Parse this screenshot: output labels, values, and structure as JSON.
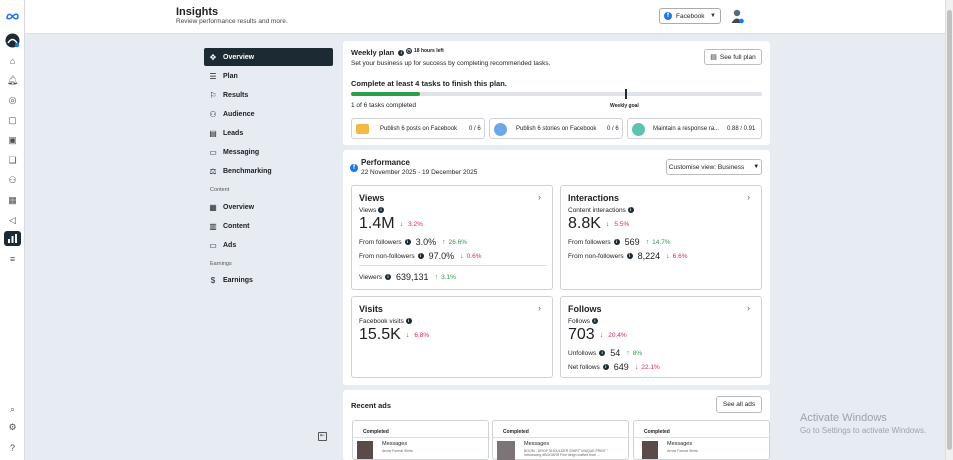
{
  "app": {
    "logo": "meta-infinity-logo"
  },
  "header": {
    "title": "Insights",
    "subtitle": "Review performance results and more.",
    "account_select": "Facebook"
  },
  "nav": {
    "items": [
      {
        "label": "Overview",
        "icon": "overview-icon"
      },
      {
        "label": "Plan",
        "icon": "list-icon"
      },
      {
        "label": "Results",
        "icon": "results-icon"
      },
      {
        "label": "Audience",
        "icon": "audience-icon"
      },
      {
        "label": "Leads",
        "icon": "leads-icon"
      },
      {
        "label": "Messaging",
        "icon": "messaging-icon"
      },
      {
        "label": "Benchmarking",
        "icon": "benchmarking-icon"
      }
    ],
    "content_section": "Content",
    "content_items": [
      {
        "label": "Overview"
      },
      {
        "label": "Content"
      },
      {
        "label": "Ads"
      }
    ],
    "earnings_section": "Earnings",
    "earnings_items": [
      {
        "label": "Earnings"
      }
    ]
  },
  "weekly_plan": {
    "title": "Weekly plan",
    "time_left": "18 hours left",
    "description": "Set your business up for success by completing recommended tasks.",
    "see_full_plan": "See full plan",
    "goal_text": "Complete at least 4 tasks to finish this plan.",
    "progress_text": "1 of 6 tasks completed",
    "progress_fraction": 0.1667,
    "goal_marker_fraction": 0.667,
    "weekly_goal_label": "Weekly goal",
    "tasks": [
      {
        "label": "Publish 6 posts on Facebook",
        "count": "0 / 6"
      },
      {
        "label": "Publish 6 stories on Facebook",
        "count": "0 / 6"
      },
      {
        "label": "Maintain a response ra...",
        "count": "0.88 / 0.91"
      }
    ]
  },
  "performance": {
    "title": "Performance",
    "date_range": "22 November 2025 - 19 December 2025",
    "customise_view": "Customise view: Business",
    "views": {
      "title": "Views",
      "metric_label": "Views",
      "value": "1.4M",
      "change": "3.2%",
      "rows": [
        {
          "label": "From followers",
          "value": "3.0%",
          "change": "26.6%",
          "dir": "up"
        },
        {
          "label": "From non-followers",
          "value": "97.0%",
          "change": "0.6%",
          "dir": "down"
        }
      ],
      "viewers_label": "Viewers",
      "viewers_value": "639,131",
      "viewers_change": "3.1%"
    },
    "interactions": {
      "title": "Interactions",
      "metric_label": "Content interactions",
      "value": "8.8K",
      "change": "5.5%",
      "rows": [
        {
          "label": "From followers",
          "value": "569",
          "change": "14.7%",
          "dir": "up"
        },
        {
          "label": "From non-followers",
          "value": "8,224",
          "change": "6.6%",
          "dir": "down"
        }
      ]
    },
    "visits": {
      "title": "Visits",
      "metric_label": "Facebook visits",
      "value": "15.5K",
      "change": "6.8%"
    },
    "follows": {
      "title": "Follows",
      "metric_label": "Follows",
      "value": "703",
      "change": "20.4%",
      "unfollows_label": "Unfollows",
      "unfollows_value": "54",
      "unfollows_change": "8%",
      "net_label": "Net follows",
      "net_value": "649",
      "net_change": "22.1%"
    }
  },
  "recent_ads": {
    "title": "Recent ads",
    "see_all": "See all ads",
    "ads": [
      {
        "status": "Completed",
        "type": "Messages",
        "desc": "Arrow Formal Shirts"
      },
      {
        "status": "Completed",
        "type": "Messages",
        "desc": "BOOM - DROP SHOULDER SHIRT\"UNIQUE PRINT \" Introducing #BOGARS Fine deign crafted from ..."
      },
      {
        "status": "Completed",
        "type": "Messages",
        "desc": "Arrow Formal Shirts"
      }
    ]
  },
  "watermark": {
    "line1": "Activate Windows",
    "line2": "Go to Settings to activate Windows."
  }
}
